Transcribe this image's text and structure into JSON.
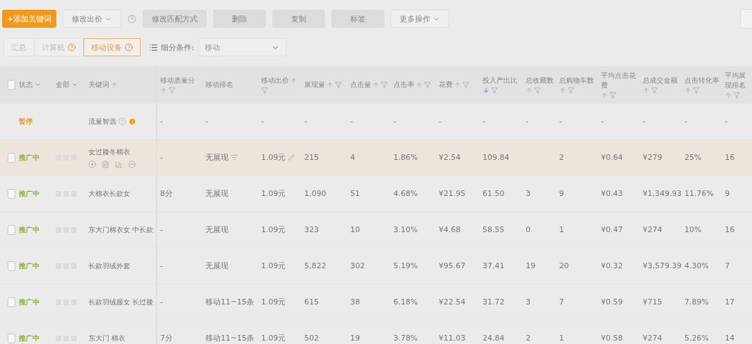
{
  "toolbar": {
    "buttons": [
      {
        "label": "+添加关键词",
        "kind": "primary"
      },
      {
        "label": "修改出价",
        "kind": "dropdown-help"
      },
      {
        "label": "修改匹配方式",
        "kind": "gray"
      },
      {
        "label": "删除",
        "kind": "gray"
      },
      {
        "label": "复制",
        "kind": "gray"
      },
      {
        "label": "标签",
        "kind": "gray"
      },
      {
        "label": "更多操作",
        "kind": "dropdown"
      }
    ]
  },
  "device_tabs": [
    {
      "label": "汇总",
      "selected": false,
      "kind": "plain"
    },
    {
      "label": "计算机",
      "selected": false,
      "kind": "help"
    },
    {
      "label": "移动设备",
      "selected": true,
      "kind": "help"
    }
  ],
  "segment": {
    "label": "细分条件:",
    "value": "移动"
  },
  "table": {
    "all_checked": false,
    "fixed_columns": [
      {
        "label": "状态",
        "kind": "dropdown"
      },
      {
        "label": "全部",
        "kind": "dropdown"
      },
      {
        "label": "关键词",
        "kind": "sort"
      }
    ],
    "columns": [
      {
        "label": "移动质量分",
        "kind": "sort-filter",
        "sorted": false
      },
      {
        "label": "移动排名",
        "kind": "plain"
      },
      {
        "label": "移动出价",
        "kind": "sort-filter",
        "sorted": false
      },
      {
        "label": "展现量",
        "kind": "sort-filter",
        "sorted": false
      },
      {
        "label": "点击量",
        "kind": "sort-filter",
        "sorted": false
      },
      {
        "label": "点击率",
        "kind": "sort-filter",
        "sorted": false
      },
      {
        "label": "花费",
        "kind": "sort-filter",
        "sorted": false
      },
      {
        "label": "投入产出比",
        "kind": "sort-filter",
        "sorted": true
      },
      {
        "label": "总收藏数",
        "kind": "sort-filter",
        "sorted": false
      },
      {
        "label": "总购物车数",
        "kind": "sort-filter",
        "sorted": false
      },
      {
        "label": "平均点击花费",
        "kind": "sort-filter",
        "sorted": false
      },
      {
        "label": "总成交金额",
        "kind": "sort-filter",
        "sorted": false
      },
      {
        "label": "点击转化率",
        "kind": "sort-filter",
        "sorted": false
      },
      {
        "label": "平均展现排名",
        "kind": "sort-filter",
        "sorted": false
      }
    ],
    "rows": [
      {
        "kind": "summary",
        "status": "暂停",
        "color": "#eb9a3a",
        "keyword": "流量智选",
        "highlighted": false,
        "cells": [
          "-",
          "-",
          "-",
          "-",
          "-",
          "-",
          "-",
          "-",
          "-",
          "-",
          "-",
          "-",
          "-",
          "-"
        ]
      },
      {
        "kind": "keyword",
        "status": "推广中",
        "color": "#8ab03a",
        "keyword": "女过膝冬棉衣",
        "highlighted": true,
        "checked": false,
        "cells": [
          "-",
          "无展现",
          "1.09元",
          "215",
          "4",
          "1.86%",
          "¥2.54",
          "109.84",
          null,
          "2",
          "¥0.64",
          "¥279",
          "25%",
          "16"
        ]
      },
      {
        "kind": "keyword",
        "status": "推广中",
        "color": "#8ab03a",
        "keyword": "大棉衣长款女",
        "highlighted": false,
        "checked": false,
        "cells": [
          "8分",
          "无展现",
          "1.09元",
          "1,090",
          "51",
          "4.68%",
          "¥21.95",
          "61.50",
          "3",
          "9",
          "¥0.43",
          "¥1,349.93",
          "11.76%",
          "9"
        ]
      },
      {
        "kind": "keyword",
        "status": "推广中",
        "color": "#8ab03a",
        "keyword": "东大门棉衣女 中长款",
        "highlighted": false,
        "checked": false,
        "cells": [
          "-",
          "无展现",
          "1.09元",
          "323",
          "10",
          "3.10%",
          "¥4.68",
          "58.55",
          "0",
          "1",
          "¥0.47",
          "¥274",
          "10%",
          "16"
        ]
      },
      {
        "kind": "keyword",
        "status": "推广中",
        "color": "#8ab03a",
        "keyword": "长款羽绒外套",
        "highlighted": false,
        "checked": false,
        "cells": [
          "-",
          "无展现",
          "1.09元",
          "5,822",
          "302",
          "5.19%",
          "¥95.67",
          "37.41",
          "19",
          "20",
          "¥0.32",
          "¥3,579.39",
          "4.30%",
          "7"
        ]
      },
      {
        "kind": "keyword",
        "status": "推广中",
        "color": "#8ab03a",
        "keyword": "长款羽绒服女 长过膝",
        "highlighted": false,
        "checked": false,
        "cells": [
          "-",
          "移动11~15条",
          "1.09元",
          "615",
          "38",
          "6.18%",
          "¥22.54",
          "31.72",
          "3",
          "7",
          "¥0.59",
          "¥715",
          "7.89%",
          "17"
        ]
      },
      {
        "kind": "keyword",
        "status": "推广中",
        "color": "#8ab03a",
        "keyword": "东大门 棉衣",
        "highlighted": false,
        "checked": false,
        "cells": [
          "7分",
          "移动11~15条",
          "1.09元",
          "502",
          "19",
          "3.78%",
          "¥11.03",
          "24.84",
          "2",
          "1",
          "¥0.58",
          "¥274",
          "5.26%",
          "14"
        ]
      }
    ]
  }
}
